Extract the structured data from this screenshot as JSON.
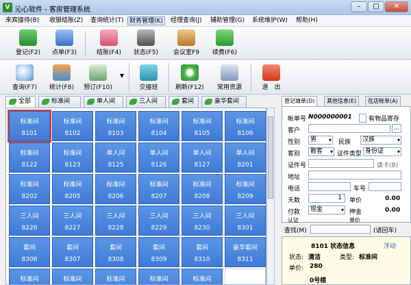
{
  "window": {
    "title": "沁心软件 - 客房管理系统",
    "logo": "V",
    "min": "–",
    "max": "□",
    "close": "✕"
  },
  "menu": [
    "来宾接待(B)",
    "收银结账(Z)",
    "查询统计(T)",
    "财务管理(K)",
    "经理查询(J)",
    "辅助管理(G)",
    "系统维护(W)",
    "帮助(H)"
  ],
  "toolbar1": [
    "登记(F2)",
    "点单(F3)",
    "结账(F4)",
    "状态(F5)",
    "会议室F9",
    "续费(F6)"
  ],
  "toolbar2": [
    "查询(F7)",
    "统计(F8)",
    "预订(F10)",
    "交接班",
    "刷新(F12)",
    "常用资源",
    "退　出"
  ],
  "room_tabs": [
    "全部",
    "标准间",
    "单人间",
    "三人间",
    "套间",
    "豪华套间"
  ],
  "rooms": [
    {
      "t": "标准间",
      "n": "8101"
    },
    {
      "t": "标准间",
      "n": "8102"
    },
    {
      "t": "标准间",
      "n": "8103"
    },
    {
      "t": "标准间",
      "n": "8104"
    },
    {
      "t": "标准间",
      "n": "8105"
    },
    {
      "t": "标准间",
      "n": "8106"
    },
    {
      "t": "标准间",
      "n": "8122"
    },
    {
      "t": "标准间",
      "n": "8123"
    },
    {
      "t": "单人间",
      "n": "8125"
    },
    {
      "t": "单人间",
      "n": "8126"
    },
    {
      "t": "单人间",
      "n": "8127"
    },
    {
      "t": "单人间",
      "n": "8201"
    },
    {
      "t": "标准间",
      "n": "8202"
    },
    {
      "t": "标准间",
      "n": "8205"
    },
    {
      "t": "标准间",
      "n": "8206"
    },
    {
      "t": "标准间",
      "n": "8207"
    },
    {
      "t": "标准间",
      "n": "8208"
    },
    {
      "t": "标准间",
      "n": "8209"
    },
    {
      "t": "三人间",
      "n": "8226"
    },
    {
      "t": "三人间",
      "n": "8227"
    },
    {
      "t": "三人间",
      "n": "8228"
    },
    {
      "t": "三人间",
      "n": "8229"
    },
    {
      "t": "三人间",
      "n": "8230"
    },
    {
      "t": "三人间",
      "n": "8301"
    },
    {
      "t": "套间",
      "n": "8306"
    },
    {
      "t": "套间",
      "n": "8307"
    },
    {
      "t": "套间",
      "n": "8308"
    },
    {
      "t": "套间",
      "n": "8309"
    },
    {
      "t": "套间",
      "n": "8310"
    },
    {
      "t": "豪华套间",
      "n": "8311"
    },
    {
      "t": "标准间",
      "n": ""
    },
    {
      "t": "标准间",
      "n": ""
    },
    {
      "t": "标准间",
      "n": ""
    },
    {
      "t": "标准间",
      "n": ""
    },
    {
      "t": "标准间",
      "n": ""
    },
    {
      "t": "",
      "n": ""
    }
  ],
  "panel_tabs": [
    "登记填单(D)",
    "其他信息(E)",
    "在店帐单(A)"
  ],
  "form": {
    "order_label": "帐单号",
    "order_no": "N000000001",
    "has_items": "有物品寄存",
    "guest_label": "客户",
    "gender_label": "性别",
    "gender": "男",
    "nation_label": "民族",
    "nation": "汉族",
    "type_label": "客别",
    "type": "散客",
    "idtype_label": "证件类型",
    "idtype": "身份证",
    "idno_label": "证件号",
    "read_card": "读卡(B)",
    "addr_label": "地址",
    "phone_label": "电话",
    "plate_label": "车号",
    "days_label": "天数",
    "days": "1",
    "price_label": "单价",
    "price": "0.00",
    "pay_label": "付款",
    "pay": "现金",
    "deposit_label": "押金",
    "deposit": "0.00",
    "extra1": "认证",
    "extra2": "单价"
  },
  "find": {
    "label": "查找(M)",
    "button": "(请回车)"
  },
  "status": {
    "title": "8101 状态信息",
    "float": "浮动",
    "state_label": "状态:",
    "state": "清洁",
    "type_label": "类型:",
    "type": "标准间",
    "price_label": "单价:",
    "price": "280",
    "next": "0号楼"
  }
}
